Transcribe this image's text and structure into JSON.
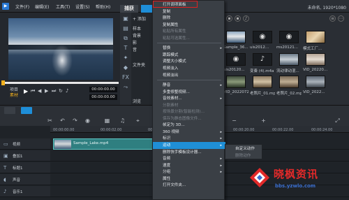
{
  "topbar": {
    "menus": [
      "文件(F)",
      "编辑(E)",
      "工具(T)",
      "设置(S)",
      "帮助(H)"
    ],
    "tabs": [
      "捕获",
      "编辑"
    ],
    "project_info": "未命名, 1920*1080"
  },
  "player": {
    "mode_labels": [
      "项目",
      "素材"
    ],
    "timecode_a": "00:00:00.00",
    "timecode_b": "00:00:00.00"
  },
  "library": {
    "add_label": "添加",
    "tree_items": [
      "样本",
      "背景",
      "影",
      "音",
      "文件夹"
    ],
    "thumbs": [
      {
        "label": "Sample_36..."
      },
      {
        "label": "uis2012..."
      },
      {
        "label": "ms20121..."
      },
      {
        "label": "模式工厂..."
      },
      {
        "label": "uis20120..."
      },
      {
        "label": "变奏 (4).m4a"
      },
      {
        "label": "流动律动混..."
      },
      {
        "label": "VID_20220..."
      },
      {
        "label": "VID_2022072..."
      },
      {
        "label": "老照片_01.mp4"
      },
      {
        "label": "老照片_02.mp4"
      },
      {
        "label": "VID_2022..."
      }
    ],
    "browse_label": "浏览"
  },
  "timeline": {
    "ticks": [
      "00:00:00.00",
      "00:00:02.00",
      "00:00:04.00",
      "00:00:20.00",
      "00:00:22.00",
      "00:00:24.00"
    ],
    "tracks": [
      "视频",
      "叠加1",
      "标题1",
      "声音",
      "音乐1"
    ],
    "clip_label": "Sample_Lake.mp4"
  },
  "context_menu": {
    "items": [
      {
        "label": "打开调项面板",
        "state": "normal"
      },
      {
        "label": "复制",
        "state": "normal"
      },
      {
        "label": "删除",
        "state": "normal"
      },
      {
        "label": "复制属性",
        "state": "normal"
      },
      {
        "label": "粘贴所有属性",
        "state": "disabled"
      },
      {
        "label": "粘贴可选属性...",
        "state": "disabled"
      },
      {
        "label": "",
        "state": "sep"
      },
      {
        "label": "替换",
        "state": "normal",
        "arrow": true
      },
      {
        "label": "跟踪模式",
        "state": "normal"
      },
      {
        "label": "调整大小模式",
        "state": "normal"
      },
      {
        "label": "视频淡入",
        "state": "normal"
      },
      {
        "label": "视频淡出",
        "state": "normal"
      },
      {
        "label": "",
        "state": "sep"
      },
      {
        "label": "静音",
        "state": "normal",
        "arrow": true
      },
      {
        "label": "多重修整视频...",
        "state": "normal"
      },
      {
        "label": "音效素材...",
        "state": "normal",
        "arrow": true
      },
      {
        "label": "分割素材",
        "state": "disabled"
      },
      {
        "label": "按场景分割(智能检测)...",
        "state": "disabled"
      },
      {
        "label": "保存为静态图像文件...",
        "state": "disabled"
      },
      {
        "label": "帧定为 3D...",
        "state": "normal"
      },
      {
        "label": "360 视频",
        "state": "normal",
        "arrow": true
      },
      {
        "label": "标识",
        "state": "normal",
        "arrow": true
      },
      {
        "label": "运动",
        "state": "highlight",
        "arrow": true
      },
      {
        "label": "删除快手模板设计器...",
        "state": "normal"
      },
      {
        "label": "音频",
        "state": "normal",
        "arrow": true
      },
      {
        "label": "速度",
        "state": "normal",
        "arrow": true
      },
      {
        "label": "分组",
        "state": "normal",
        "arrow": true
      },
      {
        "label": "属性",
        "state": "normal"
      },
      {
        "label": "打开文件夹...",
        "state": "normal"
      }
    ]
  },
  "submenu": {
    "items": [
      {
        "label": "自定义动作",
        "state": "normal"
      },
      {
        "label": "删除动作",
        "state": "disabled"
      }
    ]
  },
  "watermark": {
    "title": "晓枫资讯",
    "url": "bbs.yzwlo.com"
  },
  "colors": {
    "accent": "#1e8ed8",
    "highlight_box": "#e02020",
    "clip": "#2f7f80",
    "scrub_knob": "#f2b01e"
  }
}
